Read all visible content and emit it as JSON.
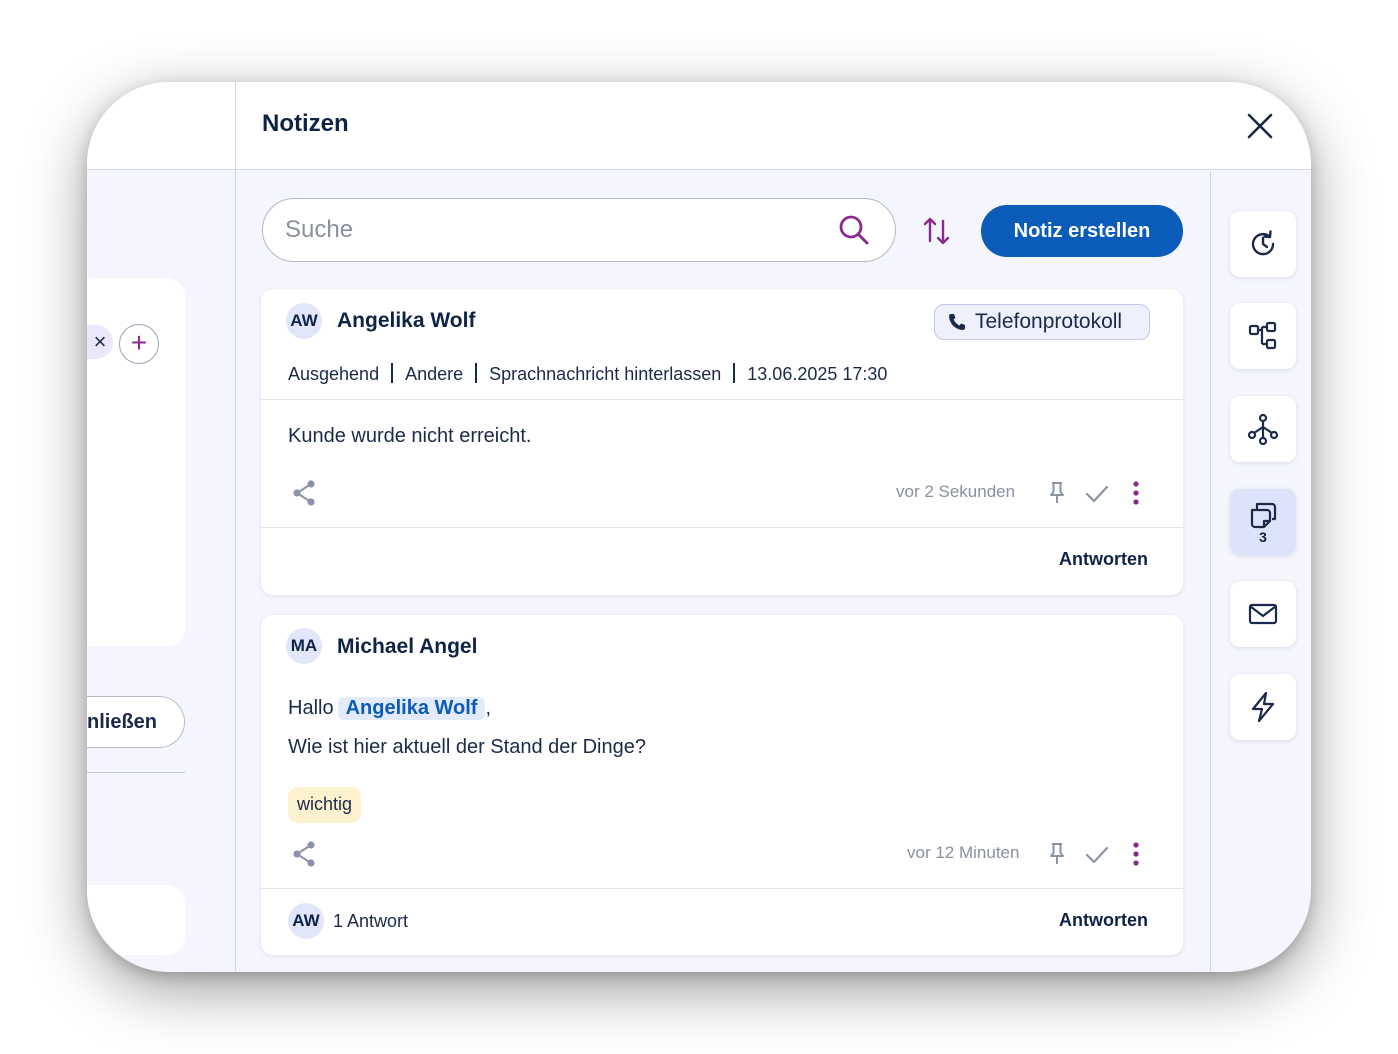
{
  "left_panel": {
    "close_button_label": "nließen",
    "chip_close": "×",
    "add_label": "+"
  },
  "header": {
    "title": "Notizen"
  },
  "toolbar": {
    "search_placeholder": "Suche",
    "create_label": "Notiz erstellen"
  },
  "notes": [
    {
      "initials": "AW",
      "author": "Angelika Wolf",
      "type_tag": "Telefonprotokoll",
      "meta": [
        "Ausgehend",
        "Andere",
        "Sprachnachricht hinterlassen",
        "13.06.2025 17:30"
      ],
      "body": "Kunde wurde nicht erreicht.",
      "time": "vor 2 Sekunden",
      "reply_label": "Antworten"
    },
    {
      "initials": "MA",
      "author": "Michael Angel",
      "greeting": "Hallo",
      "mention": "Angelika Wolf",
      "comma": ",",
      "body": "Wie ist hier aktuell der Stand der Dinge?",
      "badge": "wichtig",
      "time": "vor 12 Minuten",
      "reply_initials": "AW",
      "reply_count": "1 Antwort",
      "reply_label": "Antworten"
    }
  ],
  "sidebar": {
    "items": [
      {
        "icon": "history-icon"
      },
      {
        "icon": "workflow-icon"
      },
      {
        "icon": "network-icon"
      },
      {
        "icon": "notes-icon",
        "count": "3",
        "active": true
      },
      {
        "icon": "mail-icon"
      },
      {
        "icon": "lightning-icon"
      }
    ]
  },
  "colors": {
    "primary": "#0a5cb8",
    "accent": "#8a2a8f",
    "navy": "#0f2347",
    "panel_bg": "#f4f5fd",
    "badge_bg": "#fcf2cf"
  }
}
